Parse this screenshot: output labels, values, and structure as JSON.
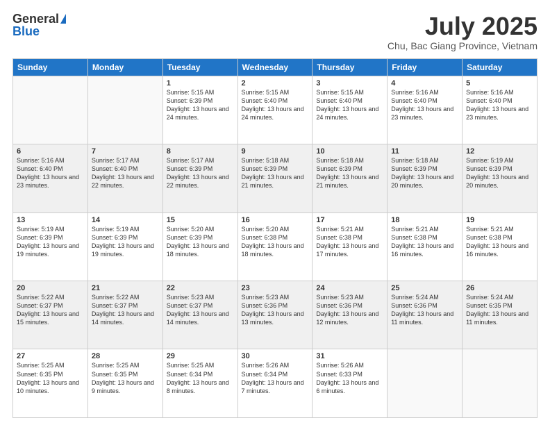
{
  "logo": {
    "general": "General",
    "blue": "Blue"
  },
  "title": "July 2025",
  "subtitle": "Chu, Bac Giang Province, Vietnam",
  "days_of_week": [
    "Sunday",
    "Monday",
    "Tuesday",
    "Wednesday",
    "Thursday",
    "Friday",
    "Saturday"
  ],
  "weeks": [
    [
      {
        "day": "",
        "info": ""
      },
      {
        "day": "",
        "info": ""
      },
      {
        "day": "1",
        "info": "Sunrise: 5:15 AM\nSunset: 6:39 PM\nDaylight: 13 hours and 24 minutes."
      },
      {
        "day": "2",
        "info": "Sunrise: 5:15 AM\nSunset: 6:40 PM\nDaylight: 13 hours and 24 minutes."
      },
      {
        "day": "3",
        "info": "Sunrise: 5:15 AM\nSunset: 6:40 PM\nDaylight: 13 hours and 24 minutes."
      },
      {
        "day": "4",
        "info": "Sunrise: 5:16 AM\nSunset: 6:40 PM\nDaylight: 13 hours and 23 minutes."
      },
      {
        "day": "5",
        "info": "Sunrise: 5:16 AM\nSunset: 6:40 PM\nDaylight: 13 hours and 23 minutes."
      }
    ],
    [
      {
        "day": "6",
        "info": "Sunrise: 5:16 AM\nSunset: 6:40 PM\nDaylight: 13 hours and 23 minutes."
      },
      {
        "day": "7",
        "info": "Sunrise: 5:17 AM\nSunset: 6:40 PM\nDaylight: 13 hours and 22 minutes."
      },
      {
        "day": "8",
        "info": "Sunrise: 5:17 AM\nSunset: 6:39 PM\nDaylight: 13 hours and 22 minutes."
      },
      {
        "day": "9",
        "info": "Sunrise: 5:18 AM\nSunset: 6:39 PM\nDaylight: 13 hours and 21 minutes."
      },
      {
        "day": "10",
        "info": "Sunrise: 5:18 AM\nSunset: 6:39 PM\nDaylight: 13 hours and 21 minutes."
      },
      {
        "day": "11",
        "info": "Sunrise: 5:18 AM\nSunset: 6:39 PM\nDaylight: 13 hours and 20 minutes."
      },
      {
        "day": "12",
        "info": "Sunrise: 5:19 AM\nSunset: 6:39 PM\nDaylight: 13 hours and 20 minutes."
      }
    ],
    [
      {
        "day": "13",
        "info": "Sunrise: 5:19 AM\nSunset: 6:39 PM\nDaylight: 13 hours and 19 minutes."
      },
      {
        "day": "14",
        "info": "Sunrise: 5:19 AM\nSunset: 6:39 PM\nDaylight: 13 hours and 19 minutes."
      },
      {
        "day": "15",
        "info": "Sunrise: 5:20 AM\nSunset: 6:39 PM\nDaylight: 13 hours and 18 minutes."
      },
      {
        "day": "16",
        "info": "Sunrise: 5:20 AM\nSunset: 6:38 PM\nDaylight: 13 hours and 18 minutes."
      },
      {
        "day": "17",
        "info": "Sunrise: 5:21 AM\nSunset: 6:38 PM\nDaylight: 13 hours and 17 minutes."
      },
      {
        "day": "18",
        "info": "Sunrise: 5:21 AM\nSunset: 6:38 PM\nDaylight: 13 hours and 16 minutes."
      },
      {
        "day": "19",
        "info": "Sunrise: 5:21 AM\nSunset: 6:38 PM\nDaylight: 13 hours and 16 minutes."
      }
    ],
    [
      {
        "day": "20",
        "info": "Sunrise: 5:22 AM\nSunset: 6:37 PM\nDaylight: 13 hours and 15 minutes."
      },
      {
        "day": "21",
        "info": "Sunrise: 5:22 AM\nSunset: 6:37 PM\nDaylight: 13 hours and 14 minutes."
      },
      {
        "day": "22",
        "info": "Sunrise: 5:23 AM\nSunset: 6:37 PM\nDaylight: 13 hours and 14 minutes."
      },
      {
        "day": "23",
        "info": "Sunrise: 5:23 AM\nSunset: 6:36 PM\nDaylight: 13 hours and 13 minutes."
      },
      {
        "day": "24",
        "info": "Sunrise: 5:23 AM\nSunset: 6:36 PM\nDaylight: 13 hours and 12 minutes."
      },
      {
        "day": "25",
        "info": "Sunrise: 5:24 AM\nSunset: 6:36 PM\nDaylight: 13 hours and 11 minutes."
      },
      {
        "day": "26",
        "info": "Sunrise: 5:24 AM\nSunset: 6:35 PM\nDaylight: 13 hours and 11 minutes."
      }
    ],
    [
      {
        "day": "27",
        "info": "Sunrise: 5:25 AM\nSunset: 6:35 PM\nDaylight: 13 hours and 10 minutes."
      },
      {
        "day": "28",
        "info": "Sunrise: 5:25 AM\nSunset: 6:35 PM\nDaylight: 13 hours and 9 minutes."
      },
      {
        "day": "29",
        "info": "Sunrise: 5:25 AM\nSunset: 6:34 PM\nDaylight: 13 hours and 8 minutes."
      },
      {
        "day": "30",
        "info": "Sunrise: 5:26 AM\nSunset: 6:34 PM\nDaylight: 13 hours and 7 minutes."
      },
      {
        "day": "31",
        "info": "Sunrise: 5:26 AM\nSunset: 6:33 PM\nDaylight: 13 hours and 6 minutes."
      },
      {
        "day": "",
        "info": ""
      },
      {
        "day": "",
        "info": ""
      }
    ]
  ]
}
